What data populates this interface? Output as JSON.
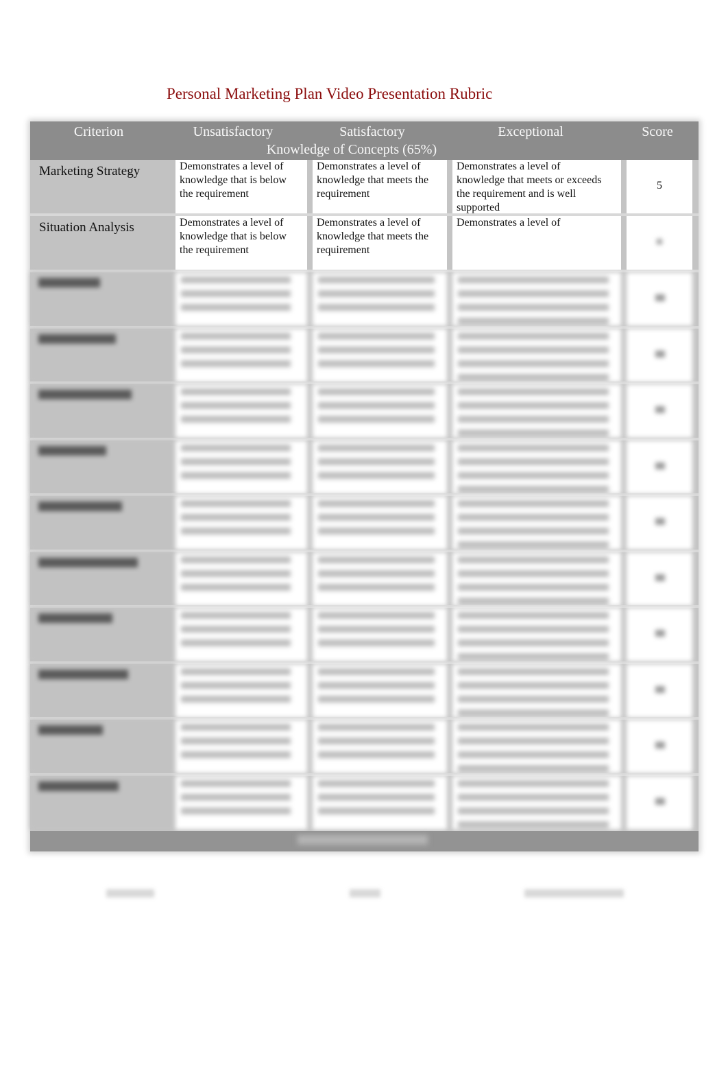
{
  "document": {
    "title": "Personal Marketing Plan Video Presentation Rubric",
    "title_color": "#8b0d0d"
  },
  "table": {
    "headers": {
      "criterion": "Criterion",
      "unsatisfactory": "Unsatisfactory",
      "satisfactory": "Satisfactory",
      "exceptional": "Exceptional",
      "score": "Score"
    },
    "section_label": "Knowledge of Concepts (65%)",
    "rows": [
      {
        "criterion": "Marketing Strategy",
        "unsatisfactory": "Demonstrates a level of knowledge that is below the requirement",
        "satisfactory": "Demonstrates a level of knowledge that meets the requirement",
        "exceptional": "Demonstrates a level of knowledge that meets or exceeds the requirement and is well supported",
        "score": "5"
      },
      {
        "criterion": "Situation Analysis",
        "unsatisfactory": "Demonstrates a level of knowledge that is below the requirement",
        "satisfactory": "Demonstrates a level of knowledge that meets the requirement",
        "exceptional": "Demonstrates a level of",
        "score": ""
      }
    ],
    "blurred_row_count": 10
  }
}
